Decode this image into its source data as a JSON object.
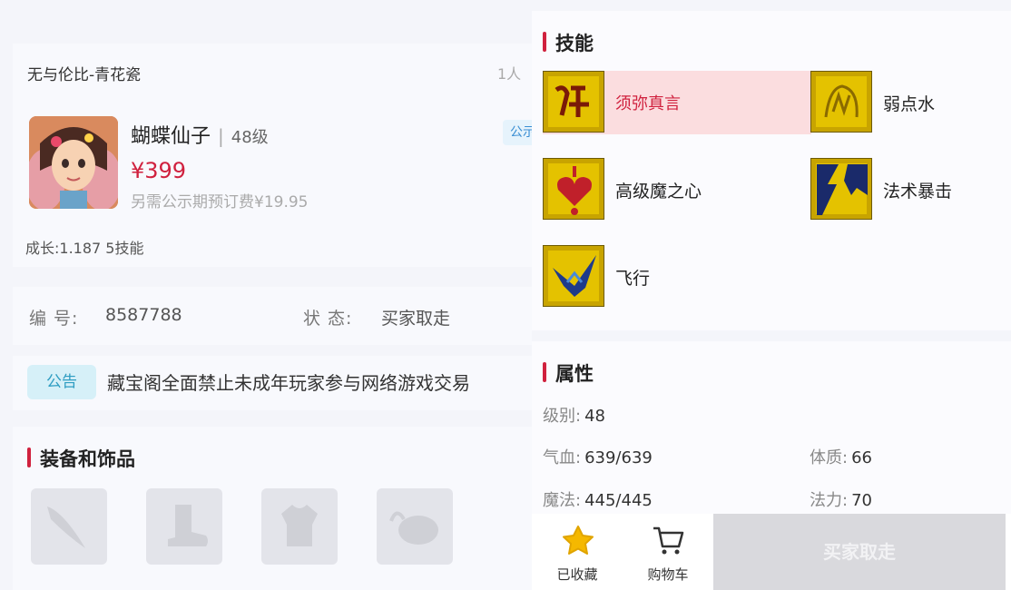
{
  "listing": {
    "server": "无与伦比-青花瓷",
    "viewers": "1人",
    "pet_name": "蝴蝶仙子",
    "separator": "|",
    "level": "48级",
    "price": "¥399",
    "fee_note": "另需公示期预订费¥19.95",
    "publicity_tag": "公示",
    "growth": "成长:1.187 5技能"
  },
  "details": {
    "id_label": "编 号:",
    "id_value": "8587788",
    "status_label": "状 态:",
    "status_value": "买家取走"
  },
  "notice": {
    "tag": "公告",
    "text": "藏宝阁全面禁止未成年玩家参与网络游戏交易"
  },
  "equipment": {
    "title": "装备和饰品",
    "slots": [
      "weapon-slot-icon",
      "boots-slot-icon",
      "armor-slot-icon",
      "accessory-slot-icon"
    ]
  },
  "skills": {
    "title": "技能",
    "items": [
      {
        "name": "须弥真言",
        "icon": "sumeru-mantra-icon",
        "selected": true
      },
      {
        "name": "弱点水",
        "icon": "water-weakness-icon",
        "selected": false
      },
      {
        "name": "高级魔之心",
        "icon": "magic-heart-icon",
        "selected": false
      },
      {
        "name": "法术暴击",
        "icon": "spell-crit-icon",
        "selected": false
      },
      {
        "name": "飞行",
        "icon": "flight-icon",
        "selected": false
      }
    ]
  },
  "attributes": {
    "title": "属性",
    "level_label": "级别:",
    "level_value": "48",
    "hp_label": "气血:",
    "hp_value": "639/639",
    "mp_label": "魔法:",
    "mp_value": "445/445",
    "con_label": "体质:",
    "con_value": "66",
    "mag_label": "法力:",
    "mag_value": "70"
  },
  "actions": {
    "favorite_label": "已收藏",
    "cart_label": "购物车",
    "buy_label": "买家取走"
  },
  "colors": {
    "accent": "#d0213e",
    "star": "#f5b800",
    "skill_gold": "#e4c200"
  }
}
